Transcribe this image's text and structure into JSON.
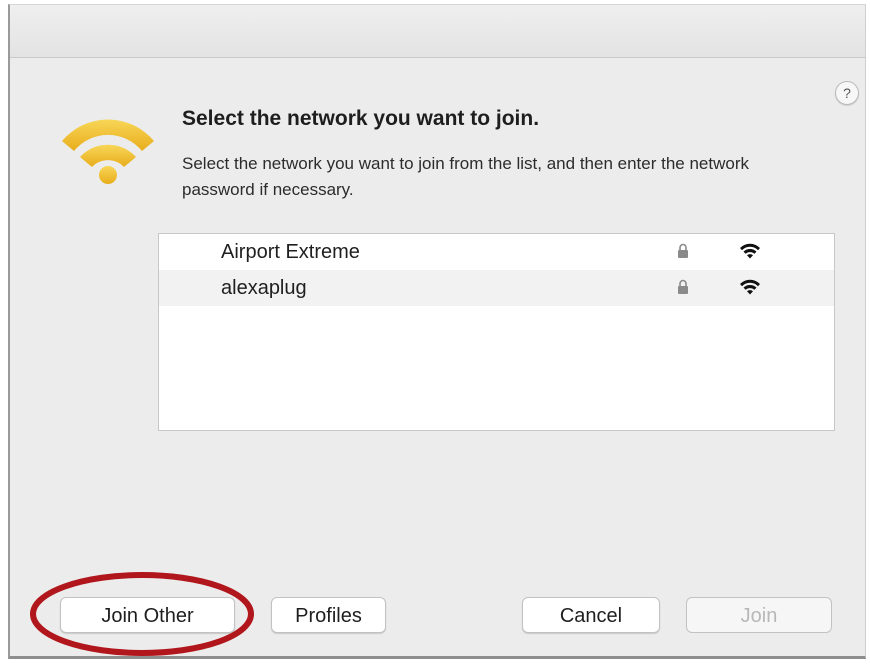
{
  "dialog": {
    "help_label": "?",
    "headline": "Select the network you want to join.",
    "description": "Select the network you want to join from the list, and then enter the network password if necessary."
  },
  "networks": [
    {
      "name": "Airport Extreme",
      "secured": true,
      "signal_icon": "wifi-signal-icon"
    },
    {
      "name": "alexaplug",
      "secured": true,
      "signal_icon": "wifi-signal-icon"
    }
  ],
  "buttons": {
    "join_other": "Join Other",
    "profiles": "Profiles",
    "cancel": "Cancel",
    "join": "Join"
  },
  "colors": {
    "wifi_accent": "#f2c230",
    "highlight_circle": "#b0161c",
    "disabled_text": "#b8b8b8"
  }
}
